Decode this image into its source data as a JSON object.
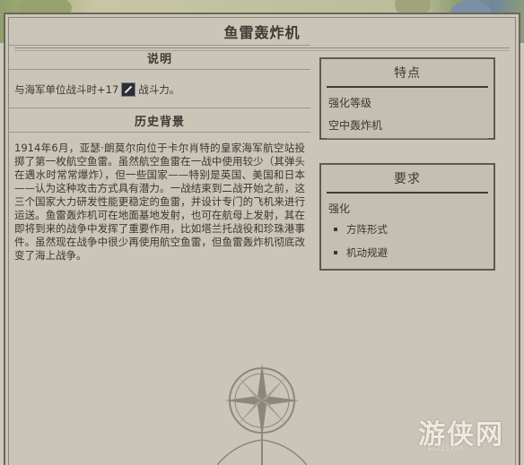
{
  "header": {
    "title": "鱼雷轰炸机"
  },
  "description": {
    "heading": "说明",
    "text_before_icon": "与海军单位战斗时+17",
    "icon": "sword-strength-icon",
    "text_after_icon": "战斗力。"
  },
  "history": {
    "heading": "历史背景",
    "text": "1914年6月，亚瑟·朗莫尔向位于卡尔肖特的皇家海军航空站投掷了第一枚航空鱼雷。虽然航空鱼雷在一战中使用较少（其弹头在遇水时常常爆炸），但一些国家——特别是英国、美国和日本——认为这种攻击方式具有潜力。一战结束到二战开始之前，这三个国家大力研发性能更稳定的鱼雷，并设计专门的飞机来进行运送。鱼雷轰炸机可在地面基地发射，也可在航母上发射，其在即将到来的战争中发挥了重要作用，比如塔兰托战役和珍珠港事件。虽然现在战争中很少再使用航空鱼雷，但鱼雷轰炸机彻底改变了海上战争。"
  },
  "traits": {
    "heading": "特点",
    "sub_heading": "强化等级",
    "item": "空中轰炸机"
  },
  "requirements": {
    "heading": "要求",
    "sub_heading": "强化",
    "items": [
      "方阵形式",
      "机动规避"
    ]
  },
  "watermark": {
    "text": "游侠网",
    "url": "ali213.net"
  },
  "colors": {
    "parchment": "#cbc5b8",
    "border": "#5e5a52",
    "text": "#3a3731"
  }
}
